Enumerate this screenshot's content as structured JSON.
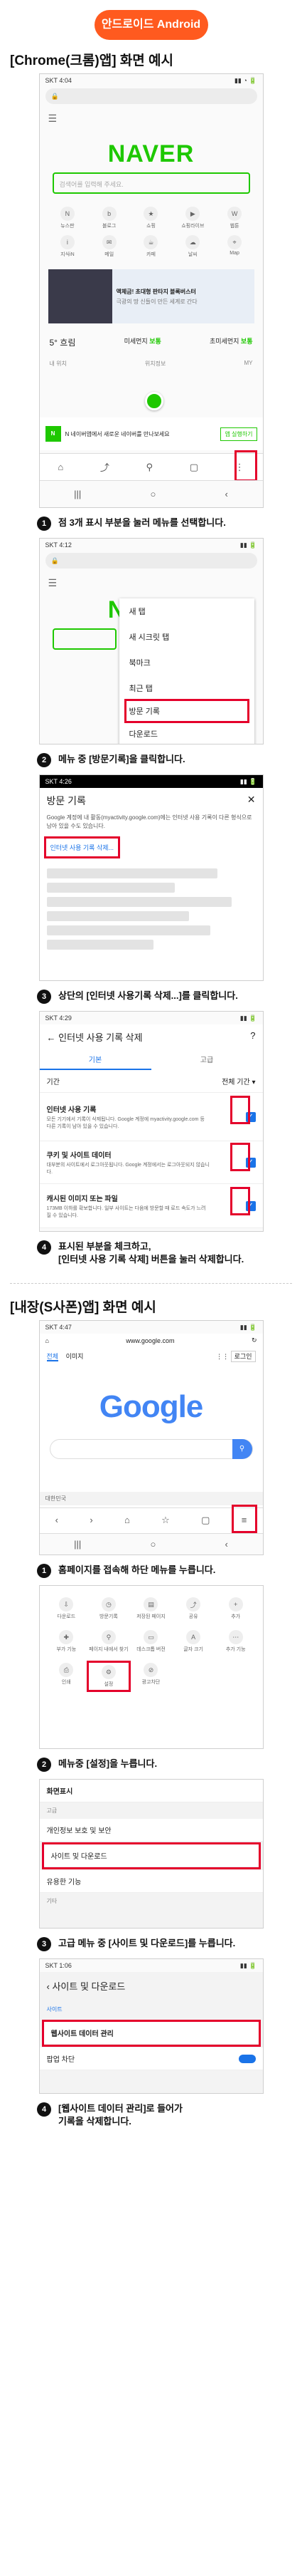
{
  "android": {
    "badge": "안드로이드 Android",
    "chrome_title": "[Chrome(크롬)앱] 화면 예시",
    "shot1": {
      "time": "SKT 4:04",
      "logo": "NAVER",
      "search_placeholder": "검색어를 입력해 주세요.",
      "icons": [
        "뉴스판",
        "블로그",
        "쇼핑",
        "쇼핑라이브",
        "웹툰",
        "지식iN",
        "메일",
        "카페",
        "날씨",
        "Map"
      ],
      "banner": "액체금! 초대형 판타지 블록버스터",
      "banner_sub": "극광의 땅 신들이 만든 세계로 간다",
      "weather_temp": "5° 흐림",
      "weather_l": "미세먼지",
      "weather_l_val": "보통",
      "weather_r": "초미세먼지",
      "weather_r_val": "보통",
      "bottom_a": "내 위치",
      "bottom_b": "위치정보",
      "bottom_c": "MY",
      "noti": "N 네이버앱에서 새로운 네이버를 만나보세요",
      "noti_btn": "앱 실행하기"
    },
    "step1": "점 3개 표시 부분을 눌러 메뉴를 선택합니다.",
    "shot2": {
      "time": "SKT 4:12",
      "logo": "NAVER",
      "menu": [
        "새 탭",
        "새 시크릿 탭",
        "북마크",
        "최근 탭",
        "방문 기록",
        "다운로드"
      ]
    },
    "step2": "메뉴 중 [방문기록]을 클릭합니다.",
    "shot3": {
      "time": "SKT 4:26",
      "title": "방문 기록",
      "desc": "Google 계정에 내 활동(myactivity.google.com)에는 인터넷 사용 기록이 다른 형식으로 남아 있을 수도 있습니다.",
      "link": "인터넷 사용 기록 삭제..."
    },
    "step3": "상단의 [인터넷 사용기록 삭제...]를 클릭합니다.",
    "shot4": {
      "time": "SKT 4:29",
      "title": "인터넷 사용 기록 삭제",
      "tab_a": "기본",
      "tab_b": "고급",
      "period_label": "기간",
      "period_val": "전체 기간",
      "items": [
        {
          "t": "인터넷 사용 기록",
          "d": "모든 기기에서 기록이 삭제됩니다. Google 계정에 myactivity.google.com 등 다른 기록이 남아 있을 수 있습니다."
        },
        {
          "t": "쿠키 및 사이트 데이터",
          "d": "대부분의 사이트에서 로그아웃됩니다. Google 계정에서는 로그아웃되지 않습니다."
        },
        {
          "t": "캐시된 이미지 또는 파일",
          "d": "173MB 이하를 확보합니다. 일부 사이트는 다음에 방문할 때 로드 속도가 느려질 수 있습니다."
        }
      ]
    },
    "step4a": "표시된 부분을 체크하고,",
    "step4b": "[인터넷 사용 기록 삭제] 버튼을 눌러 삭제합니다."
  },
  "samsung": {
    "title": "[내장(S사폰)앱] 화면 예시",
    "shot1": {
      "time": "SKT 4:47",
      "url": "www.google.com",
      "tab_a": "전체",
      "tab_b": "이미지",
      "login": "로그인",
      "logo": "Google",
      "region": "대한민국"
    },
    "step1": "홈페이지를 접속해 하단 메뉴를 누릅니다.",
    "shot2": {
      "icons": [
        "다운로드",
        "방문기록",
        "저장된 페이지",
        "공유",
        "추가",
        "부가 기능",
        "페이지 내에서 찾기",
        "데스크톱 버전",
        "글자 크기",
        "추가 기능",
        "인쇄",
        "설정",
        "광고차단"
      ],
      "settings_label": "설정"
    },
    "step2": "메뉴중 [설정]을 누릅니다.",
    "shot3": {
      "items": [
        "화면표시",
        "고급",
        "개인정보 보호 및 보안",
        "사이트 및 다운로드",
        "유용한 기능",
        "기타"
      ],
      "selected": "사이트 및 다운로드"
    },
    "step3": "고급 메뉴 중 [사이트 및 다운로드]를 누릅니다.",
    "shot4": {
      "time": "SKT 1:06",
      "title": "사이트 및 다운로드",
      "section": "사이트",
      "row": "웹사이트 데이터 관리",
      "row2": "팝업 차단"
    },
    "step4a": "[웹사이트 데이터 관리]로 들어가",
    "step4b": "기록을 삭제합니다."
  },
  "colors": {
    "accent": "#ff5a1f",
    "naver": "#1ec800",
    "highlight": "#e4002b"
  }
}
